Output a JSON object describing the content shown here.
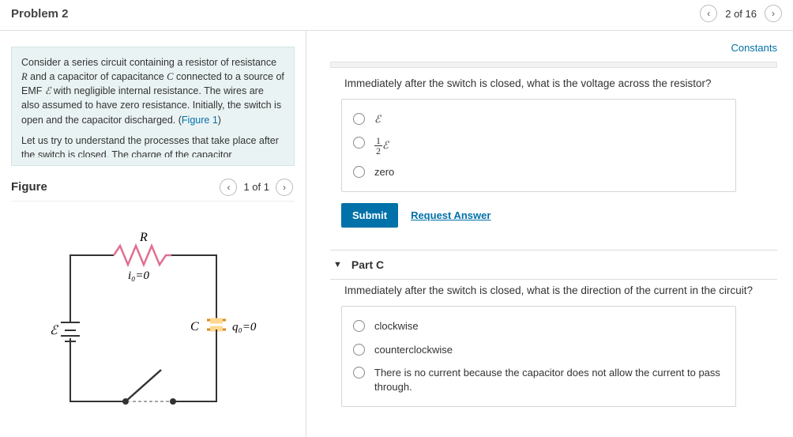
{
  "header": {
    "title": "Problem 2",
    "nav_text": "2 of 16"
  },
  "constants_link": "Constants",
  "consider": {
    "p1_a": "Consider a series circuit containing a resistor of resistance ",
    "p1_b": " and a capacitor of capacitance ",
    "p1_c": " connected to a source of EMF ",
    "p1_d": " with negligible internal resistance. The wires are also assumed to have zero resistance. Initially, the switch is open and the capacitor discharged. (",
    "fig_link": "Figure 1",
    "p1_e": ")",
    "p2": "Let us try to understand the processes that take place after the switch is closed. The charge of the capacitor",
    "R": "R",
    "C": "C",
    "E": "ℰ"
  },
  "figure": {
    "title": "Figure",
    "nav_text": "1 of 1",
    "labels": {
      "R": "R",
      "i0": "i₀=0",
      "C": "C",
      "q0": "q₀=0",
      "E": "ℰ"
    }
  },
  "partB": {
    "question": "Immediately after the switch is closed, what is the voltage across the resistor?",
    "options": {
      "o1": "ℰ",
      "o2_num": "1",
      "o2_den": "2",
      "o2_tail": "ℰ",
      "o3": "zero"
    },
    "submit": "Submit",
    "request": "Request Answer"
  },
  "partC": {
    "title": "Part C",
    "question": "Immediately after the switch is closed, what is the direction of the current in the circuit?",
    "options": {
      "o1": "clockwise",
      "o2": "counterclockwise",
      "o3": "There is no current because the capacitor does not allow the current to pass through."
    }
  }
}
